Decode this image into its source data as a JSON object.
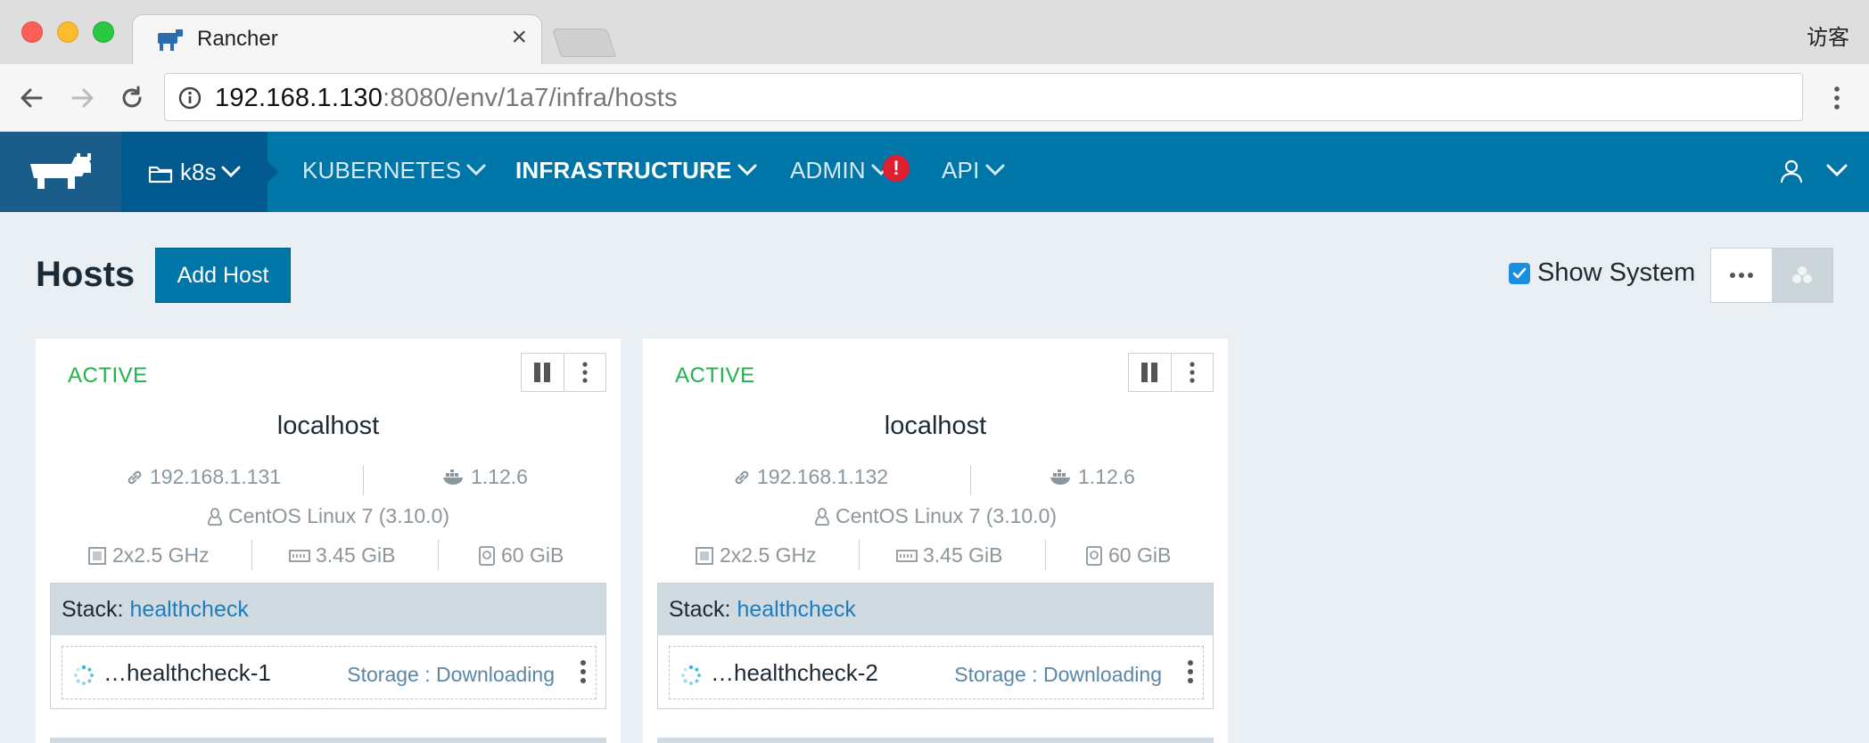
{
  "browser": {
    "tab_title": "Rancher",
    "tab_close": "×",
    "profile_label": "访客",
    "url_host": "192.168.1.130",
    "url_path": ":8080/env/1a7/infra/hosts"
  },
  "header": {
    "env_label": "k8s",
    "nav": [
      {
        "label": "KUBERNETES",
        "active": false
      },
      {
        "label": "INFRASTRUCTURE",
        "active": true
      },
      {
        "label": "ADMIN",
        "active": false
      },
      {
        "label": "API",
        "active": false
      }
    ],
    "admin_alert": "!",
    "brand_color": "#0075a8"
  },
  "page": {
    "title": "Hosts",
    "add_host_label": "Add Host",
    "show_system_label": "Show System",
    "show_system_checked": true
  },
  "hosts": [
    {
      "state": "ACTIVE",
      "name": "localhost",
      "ip": "192.168.1.131",
      "docker_version": "1.12.6",
      "os": "CentOS Linux 7 (3.10.0)",
      "cpu": "2x2.5 GHz",
      "memory": "3.45 GiB",
      "storage": "60 GiB",
      "stack_label": "Stack:",
      "stack_name": "healthcheck",
      "container_name": "…healthcheck-1",
      "container_status": "Storage : Downloading"
    },
    {
      "state": "ACTIVE",
      "name": "localhost",
      "ip": "192.168.1.132",
      "docker_version": "1.12.6",
      "os": "CentOS Linux 7 (3.10.0)",
      "cpu": "2x2.5 GHz",
      "memory": "3.45 GiB",
      "storage": "60 GiB",
      "stack_label": "Stack:",
      "stack_name": "healthcheck",
      "container_name": "…healthcheck-2",
      "container_status": "Storage : Downloading"
    }
  ]
}
